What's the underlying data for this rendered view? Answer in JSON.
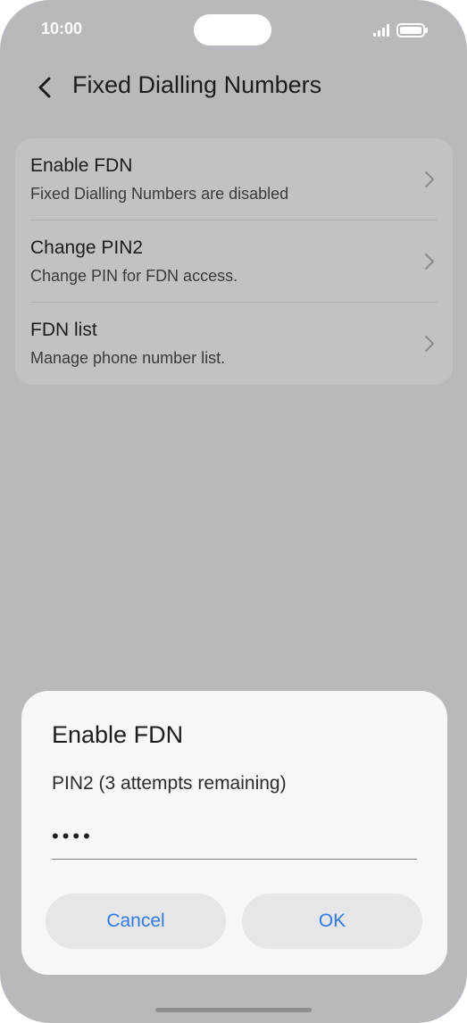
{
  "status_bar": {
    "time": "10:00",
    "icons": [
      "signal-icon",
      "battery-icon"
    ]
  },
  "header": {
    "back_icon": "chevron-left-icon",
    "title": "Fixed Dialling Numbers"
  },
  "settings": {
    "items": [
      {
        "title": "Enable FDN",
        "subtitle": "Fixed Dialling Numbers are disabled"
      },
      {
        "title": "Change PIN2",
        "subtitle": "Change PIN for FDN access."
      },
      {
        "title": "FDN list",
        "subtitle": "Manage phone number list."
      }
    ]
  },
  "dialog": {
    "title": "Enable FDN",
    "label": "PIN2 (3 attempts remaining)",
    "pin_masked": "••••",
    "cancel_label": "Cancel",
    "ok_label": "OK"
  },
  "colors": {
    "accent": "#2f7be4",
    "dim_background": "#b9b9bd",
    "dialog_background": "#f7f7f9"
  }
}
